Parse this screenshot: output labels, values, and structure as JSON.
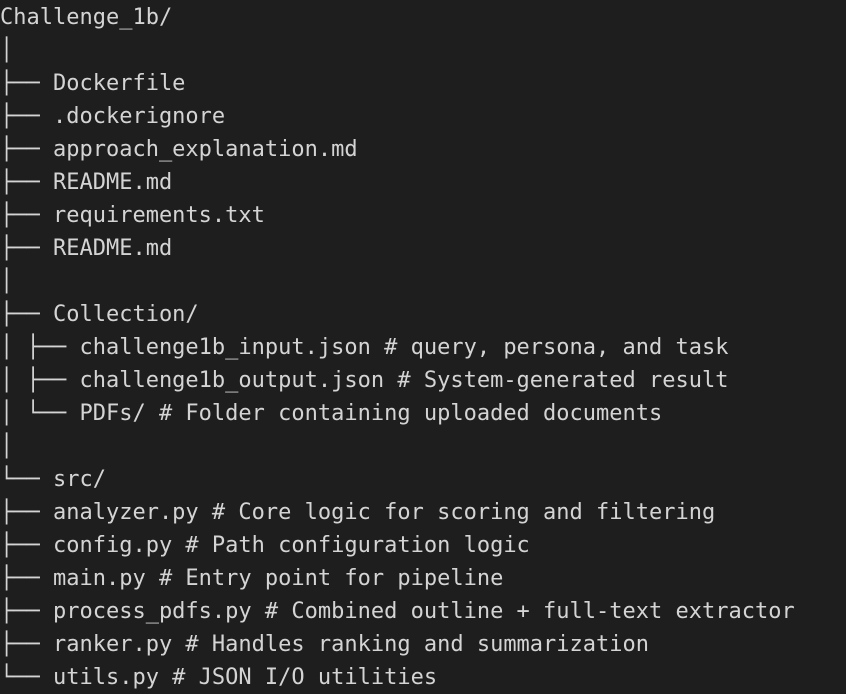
{
  "terminal": {
    "lines": [
      "Challenge_1b/",
      "│",
      "├── Dockerfile",
      "├── .dockerignore",
      "├── approach_explanation.md",
      "├── README.md",
      "├── requirements.txt",
      "├── README.md",
      "│",
      "├── Collection/",
      "│ ├── challenge1b_input.json # query, persona, and task",
      "│ ├── challenge1b_output.json # System-generated result",
      "│ └── PDFs/ # Folder containing uploaded documents",
      "│",
      "└── src/",
      "├── analyzer.py # Core logic for scoring and filtering",
      "├── config.py # Path configuration logic",
      "├── main.py # Entry point for pipeline",
      "├── process_pdfs.py # Combined outline + full-text extractor",
      "├── ranker.py # Handles ranking and summarization",
      "└── utils.py # JSON I/O utilities"
    ]
  }
}
